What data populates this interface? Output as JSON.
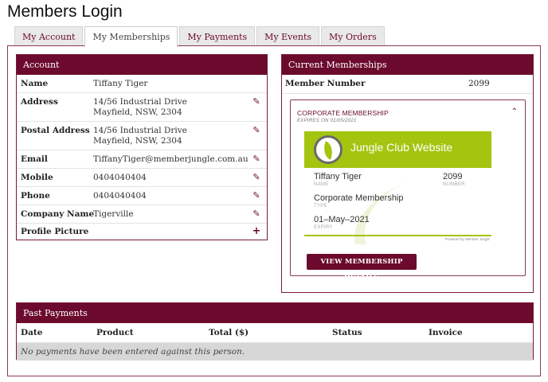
{
  "page": {
    "title": "Members Login"
  },
  "tabs": [
    {
      "label": "My Account"
    },
    {
      "label": "My Memberships"
    },
    {
      "label": "My Payments"
    },
    {
      "label": "My Events"
    },
    {
      "label": "My Orders"
    }
  ],
  "active_tab": "My Memberships",
  "colors": {
    "brand": "#6b0a2c",
    "card_green": "#a3c50f",
    "row_grey": "#d7d7d7"
  },
  "account": {
    "heading": "Account",
    "fields": [
      {
        "label": "Name",
        "line1": "Tiffany Tiger",
        "line2": "",
        "action": ""
      },
      {
        "label": "Address",
        "line1": "14/56 Industrial Drive",
        "line2": "Mayfield, NSW, 2304",
        "action": "edit-icon"
      },
      {
        "label": "Postal Address",
        "line1": "14/56 Industrial Drive",
        "line2": "Mayfield, NSW, 2304",
        "action": "edit-icon"
      },
      {
        "label": "Email",
        "line1": "TiffanyTiger@memberjungle.com.au",
        "line2": "",
        "action": "edit-icon"
      },
      {
        "label": "Mobile",
        "line1": "0404040404",
        "line2": "",
        "action": "edit-icon"
      },
      {
        "label": "Phone",
        "line1": "0404040404",
        "line2": "",
        "action": "edit-icon"
      },
      {
        "label": "Company Name",
        "line1": "Tigerville",
        "line2": "",
        "action": "edit-icon"
      },
      {
        "label": "Profile Picture",
        "line1": "",
        "line2": "",
        "action": "plus-icon"
      }
    ]
  },
  "current_memberships": {
    "heading": "Current Memberships",
    "member_number_label": "Member Number",
    "member_number": "2099",
    "membership": {
      "title": "CORPORATE MEMBERSHIP",
      "expires": "EXPIRES ON 01/05/2021",
      "card": {
        "brand": "Jungle Club Website",
        "name": "Tiffany Tiger",
        "name_caption": "NAME",
        "number": "2099",
        "number_caption": "NUMBER",
        "type": "Corporate Membership",
        "type_caption": "TYPE",
        "expiry": "01–May–2021",
        "expiry_caption": "EXPIRY",
        "powered_by": "Powered by Member Jungle"
      },
      "button": "VIEW MEMBERSHIP DETAILS"
    }
  },
  "past_payments": {
    "heading": "Past Payments",
    "columns": [
      "Date",
      "Product",
      "Total ($)",
      "Status",
      "Invoice"
    ],
    "empty_message": "No payments have been entered against this person."
  }
}
